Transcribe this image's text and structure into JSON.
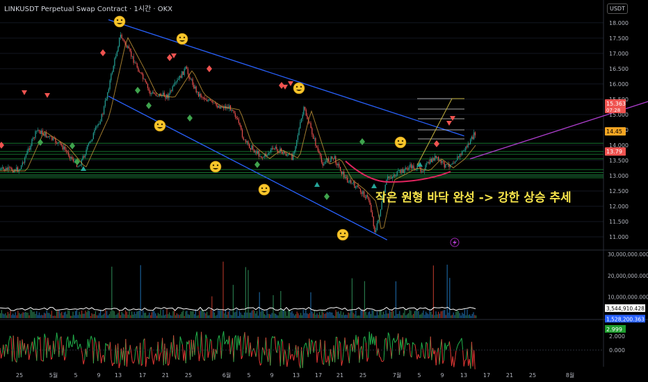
{
  "title": "LINKUSDT Perpetual Swap Contract · 1시간 · OKX",
  "currency": "USDT",
  "annotation": "작은 원형 바닥 완성 -> 강한 상승 추세",
  "colors": {
    "up": "#26a69a",
    "down": "#ef5350",
    "channel": "#2962ff",
    "trend": "#b03fd0",
    "annotation": "#f5e34b",
    "ma": "#c89a3a",
    "hline": "#1b8f3a"
  },
  "chart_data": [
    {
      "type": "line",
      "name": "price",
      "ylim": [
        10.75,
        18.2
      ],
      "y_ticks": [
        "18.000",
        "17.500",
        "17.000",
        "16.500",
        "16.000",
        "15.500",
        "15.000",
        "14.500",
        "14.000",
        "13.500",
        "13.000",
        "12.500",
        "12.000",
        "11.500",
        "11.000"
      ],
      "y_tick_values": [
        18,
        17.5,
        17,
        16.5,
        16,
        15.5,
        15,
        14.5,
        14,
        13.5,
        13,
        12.5,
        12,
        11.5,
        11
      ],
      "x_ticks": [
        "25",
        "5월",
        "5",
        "9",
        "13",
        "17",
        "21",
        "25",
        "6월",
        "5",
        "9",
        "13",
        "17",
        "21",
        "25",
        "7월",
        "5",
        "9",
        "13",
        "17",
        "21",
        "25",
        "8월"
      ],
      "x": [
        "2024-04-25",
        "2024-04-28",
        "2024-05-02",
        "2024-05-05",
        "2024-05-09",
        "2024-05-12",
        "2024-05-15",
        "2024-05-17",
        "2024-05-20",
        "2024-05-23",
        "2024-05-25",
        "2024-05-28",
        "2024-05-31",
        "2024-06-02",
        "2024-06-05",
        "2024-06-07",
        "2024-06-10",
        "2024-06-12",
        "2024-06-13",
        "2024-06-15",
        "2024-06-17",
        "2024-06-19",
        "2024-06-21",
        "2024-06-23",
        "2024-06-24",
        "2024-06-26",
        "2024-06-28",
        "2024-06-30",
        "2024-07-02",
        "2024-07-04",
        "2024-07-06",
        "2024-07-08",
        "2024-07-10",
        "2024-07-11"
      ],
      "y": [
        13.2,
        14.5,
        14.0,
        13.3,
        15.0,
        17.6,
        16.5,
        15.7,
        15.6,
        16.5,
        15.7,
        15.3,
        15.2,
        14.1,
        13.6,
        13.9,
        13.6,
        15.2,
        14.6,
        13.4,
        13.6,
        12.9,
        12.6,
        12.2,
        11.1,
        12.9,
        13.1,
        13.3,
        13.2,
        13.6,
        13.3,
        13.6,
        14.1,
        14.45
      ],
      "price_labels": [
        {
          "text": "15.363",
          "sub": "07:28",
          "value": 15.363,
          "color": "#ef5350"
        },
        {
          "text": "14.45",
          "value": 14.45,
          "color": "#f5a623"
        },
        {
          "text": "13.79",
          "value": 13.79,
          "color": "#ef5350"
        }
      ],
      "horizontal_levels": [
        14.06,
        13.79,
        13.7,
        13.55,
        13.2,
        13.1,
        13.03,
        12.98,
        12.93
      ],
      "channel_upper": [
        [
          "2024-05-10",
          18.1
        ],
        [
          "2024-07-09",
          14.3
        ]
      ],
      "channel_lower": [
        [
          "2024-05-10",
          15.6
        ],
        [
          "2024-06-26",
          10.9
        ]
      ],
      "trendline": [
        [
          "2024-07-10",
          13.55
        ],
        [
          "2024-08-11",
          15.55
        ]
      ]
    },
    {
      "type": "bar",
      "name": "volume",
      "y_ticks": [
        "30,000,000.000",
        "20,000,000.000",
        "10,000,000.000"
      ],
      "y_tick_values": [
        30000000,
        20000000,
        10000000
      ],
      "labels": [
        {
          "text": "3,544,910.428",
          "value": 3544910.428,
          "color": "#ffffff"
        },
        {
          "text": "1,528,200.363",
          "value": 1528200.363,
          "color": "#2962ff"
        }
      ]
    },
    {
      "type": "line",
      "name": "oscillator",
      "y_ticks": [
        "2.000",
        "0.000"
      ],
      "y_tick_values": [
        2,
        0
      ],
      "labels": [
        {
          "text": "2.999",
          "value": 2.999,
          "color": "#1e9e2e"
        }
      ]
    }
  ]
}
